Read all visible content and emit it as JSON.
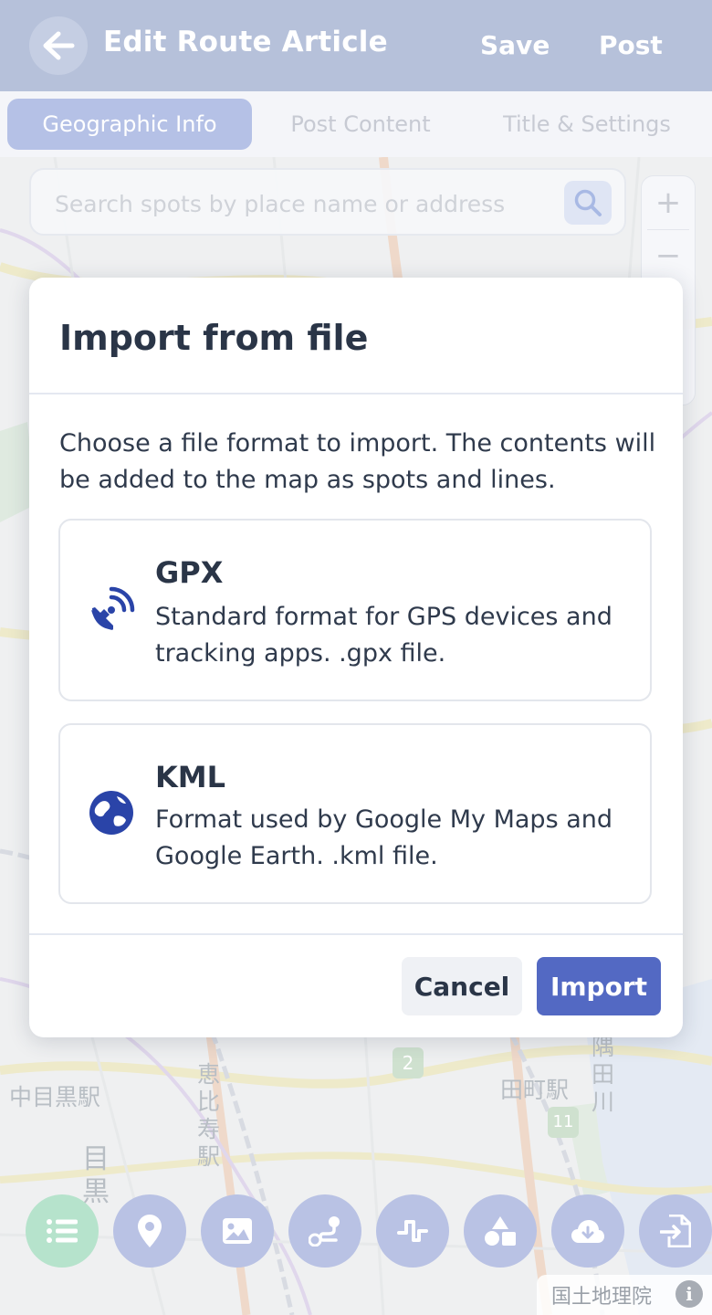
{
  "header": {
    "title": "Edit Route Article",
    "save_label": "Save",
    "post_label": "Post",
    "back_icon": "arrow-left-icon"
  },
  "tabs": [
    {
      "label": "Geographic Info",
      "active": true
    },
    {
      "label": "Post Content",
      "active": false
    },
    {
      "label": "Title & Settings",
      "active": false
    }
  ],
  "search": {
    "placeholder": "Search spots by place name or address",
    "icon": "search-icon"
  },
  "zoom": {
    "in_label": "+",
    "out_label": "−"
  },
  "modal": {
    "title": "Import from file",
    "description": "Choose a file format to import. The contents will be added to the map as spots and lines.",
    "options": [
      {
        "title": "GPX",
        "description": "Standard format for GPS devices and tracking apps. .gpx file.",
        "icon": "satellite-dish-icon"
      },
      {
        "title": "KML",
        "description": "Format used by Google My Maps and Google Earth. .kml file.",
        "icon": "globe-icon"
      }
    ],
    "cancel_label": "Cancel",
    "import_label": "Import"
  },
  "toolbar": [
    {
      "icon": "list-icon"
    },
    {
      "icon": "map-pin-icon"
    },
    {
      "icon": "image-icon"
    },
    {
      "icon": "route-icon"
    },
    {
      "icon": "elevation-icon"
    },
    {
      "icon": "shapes-icon"
    },
    {
      "icon": "cloud-download-icon"
    },
    {
      "icon": "file-import-icon"
    }
  ],
  "attribution": {
    "label": "国土地理院",
    "info_label": "i"
  },
  "map_labels": {
    "naka_meguro": "中目黒駅",
    "ebisu": "恵比寿駅",
    "meguro": "目黒",
    "tamachi": "田町駅",
    "wan": "隅田川",
    "route_2": "2",
    "route_11": "11"
  },
  "colors": {
    "header_bg": "#b6c1da",
    "tab_active": "#b5c1e6",
    "primary": "#5369c3",
    "icon_blue": "#2a44a8",
    "toolbar_btn": "#b9c2e4",
    "toolbar_green": "#b6e3cc"
  }
}
